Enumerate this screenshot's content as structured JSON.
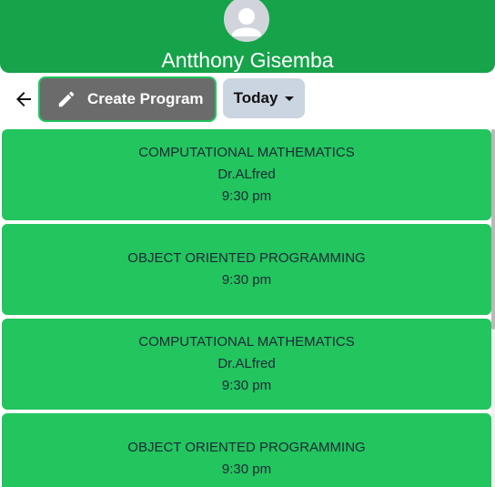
{
  "header": {
    "user_name": "Antthony Gisemba",
    "avatar_icon": "user-avatar-icon",
    "background_color": "#16a34a"
  },
  "toolbar": {
    "back_icon": "arrow-left-icon",
    "create_label": "Create Program",
    "create_icon": "pencil-icon",
    "filter_label": "Today",
    "filter_icon": "caret-down-icon"
  },
  "programs": [
    {
      "title": "COMPUTATIONAL MATHEMATICS",
      "lecturer": "Dr.ALfred",
      "time": "9:30 pm"
    },
    {
      "title": "OBJECT ORIENTED PROGRAMMING",
      "time": "9:30 pm"
    },
    {
      "title": "COMPUTATIONAL MATHEMATICS",
      "lecturer": "Dr.ALfred",
      "time": "9:30 pm"
    },
    {
      "title": "OBJECT ORIENTED PROGRAMMING",
      "time": "9:30 pm"
    }
  ],
  "colors": {
    "card": "#22c55e",
    "create_button": "#6b6b6b",
    "filter_button": "#cbd5e1"
  }
}
